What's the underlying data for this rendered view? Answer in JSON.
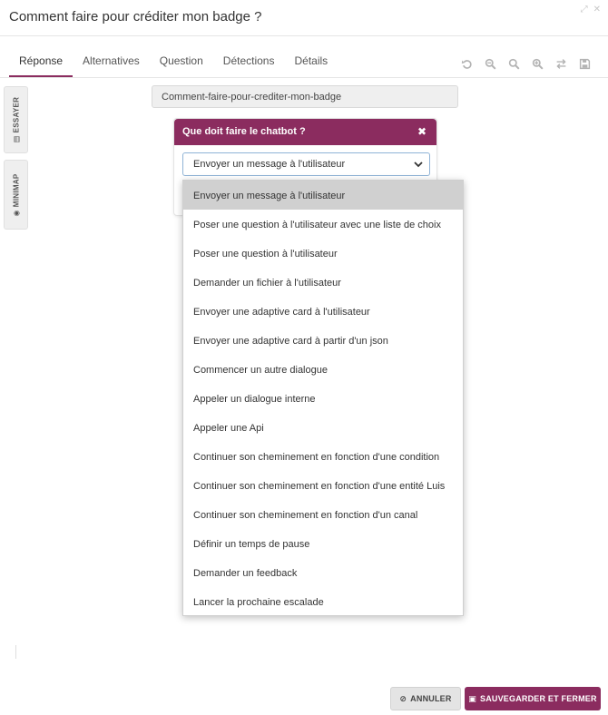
{
  "window": {
    "title": "Comment faire pour créditer mon badge ?"
  },
  "tabs": [
    {
      "label": "Réponse",
      "active": true
    },
    {
      "label": "Alternatives"
    },
    {
      "label": "Question"
    },
    {
      "label": "Détections"
    },
    {
      "label": "Détails"
    }
  ],
  "toolbar": {
    "icons": [
      "undo-icon",
      "zoom-out-icon",
      "zoom-reset-icon",
      "zoom-in-icon",
      "swap-icon",
      "save-icon"
    ],
    "icon_color": "#b3b3b3"
  },
  "side_tabs": {
    "essayer": "ESSAYER",
    "minimap": "MINIMAP"
  },
  "node": {
    "name": "Comment-faire-pour-crediter-mon-badge"
  },
  "card": {
    "title": "Que doit faire le chatbot ?",
    "selected_value": "Envoyer un message à l'utilisateur"
  },
  "dropdown": {
    "options": [
      "Envoyer un message à l'utilisateur",
      "Poser une question à l'utilisateur avec une liste de choix",
      "Poser une question à l'utilisateur",
      "Demander un fichier à l'utilisateur",
      "Envoyer une adaptive card à l'utilisateur",
      "Envoyer une adaptive card à partir d'un json",
      "Commencer un autre dialogue",
      "Appeler un dialogue interne",
      "Appeler une Api",
      "Continuer son cheminement en fonction d'une condition",
      "Continuer son cheminement en fonction d'une entité Luis",
      "Continuer son cheminement en fonction d'un canal",
      "Définir un temps de pause",
      "Demander un feedback",
      "Lancer la prochaine escalade"
    ],
    "selected_index": 0
  },
  "footer": {
    "cancel_label": "ANNULER",
    "save_label": "SAUVEGARDER ET FERMER"
  },
  "colors": {
    "accent": "#8b2c5f",
    "selected_option_bg": "#d0d0d0"
  }
}
